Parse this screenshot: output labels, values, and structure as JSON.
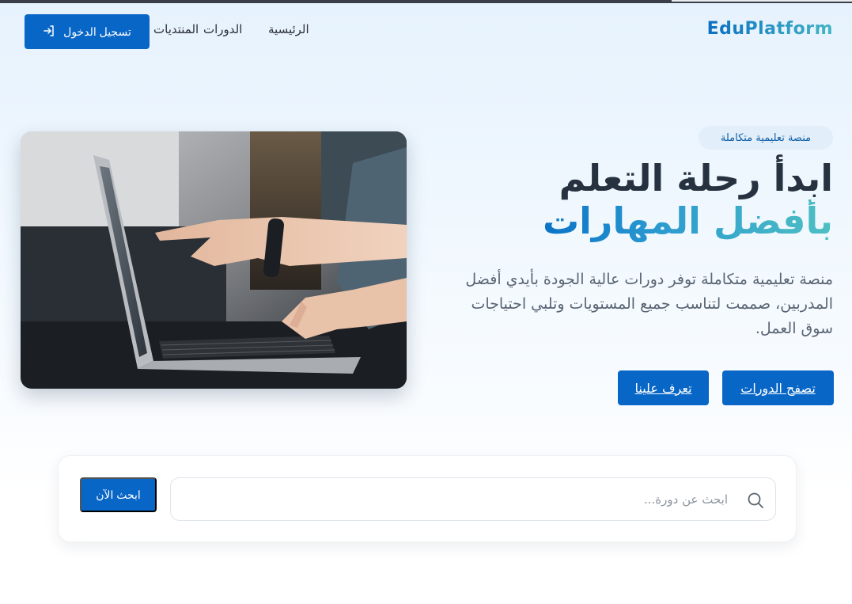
{
  "brand": {
    "logo_text": "EduPlatform"
  },
  "nav": {
    "items": [
      {
        "label": "الرئيسية"
      },
      {
        "label": "الدورات"
      },
      {
        "label": "المنتديات"
      }
    ],
    "login_label": "تسجيل الدخول"
  },
  "hero": {
    "badge": "منصة تعليمية متكاملة",
    "title_line1": "ابدأ رحلة التعلم",
    "title_line2": "بأفضل المهارات",
    "description": "منصة تعليمية متكاملة توفر دورات عالية الجودة بأيدي أفضل المدربين، صممت لتناسب جميع المستويات وتلبي احتياجات سوق العمل.",
    "browse_label": "تصفح الدورات",
    "about_label": "تعرف علينا"
  },
  "search": {
    "placeholder": "ابحث عن دورة...",
    "value": "",
    "button_label": "ابحث الآن"
  },
  "colors": {
    "primary": "#0866c6",
    "accent_teal": "#45b6c4",
    "heading": "#26323f"
  }
}
